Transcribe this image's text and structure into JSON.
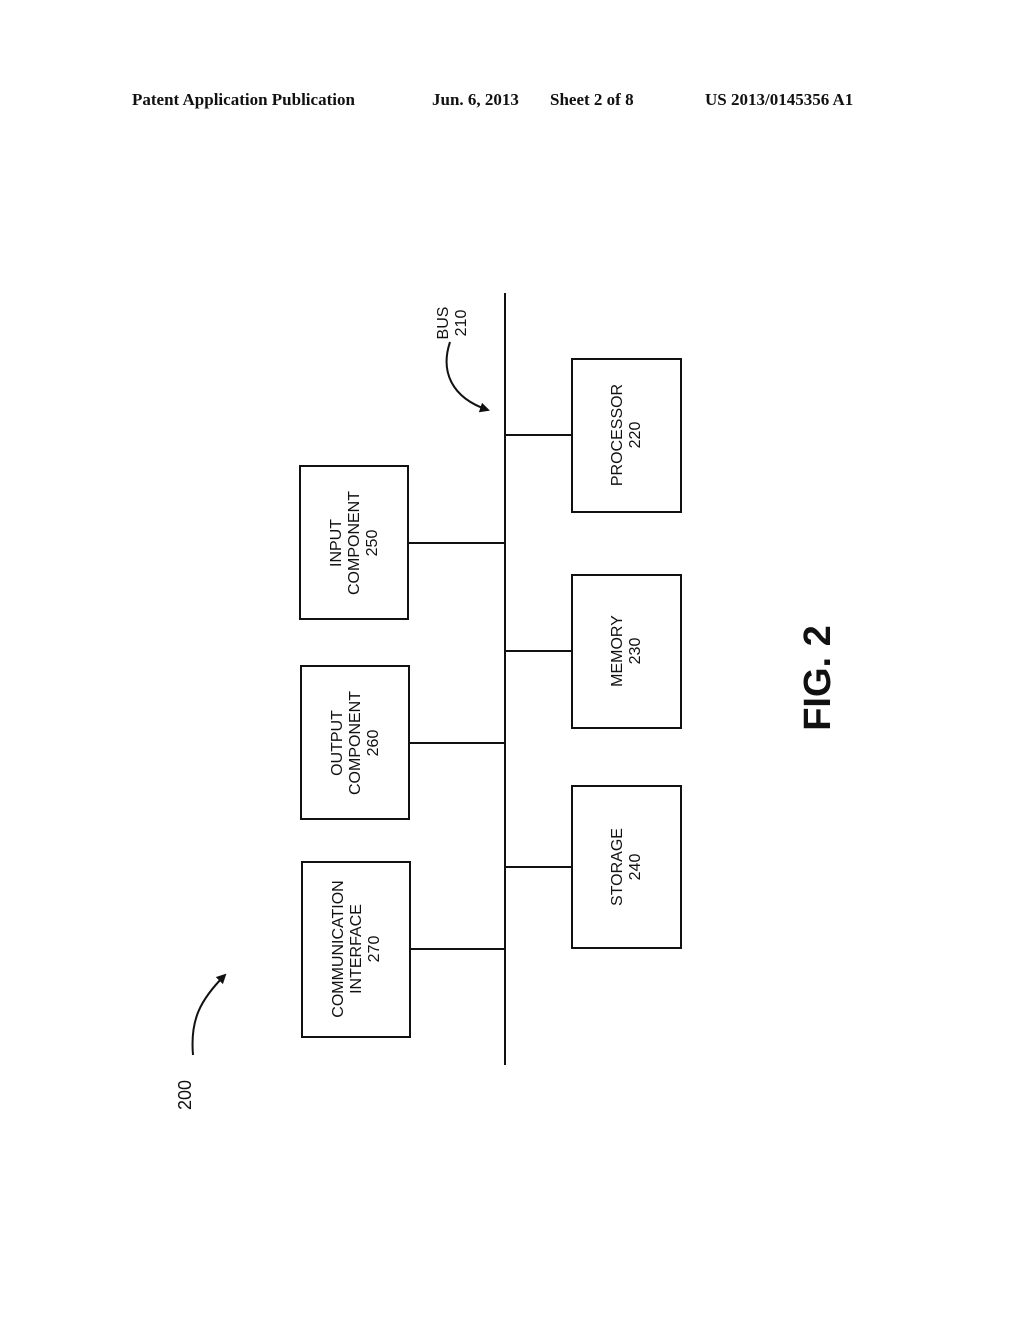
{
  "header": {
    "publication": "Patent Application Publication",
    "date": "Jun. 6, 2013",
    "sheet": "Sheet 2 of 8",
    "number": "US 2013/0145356 A1"
  },
  "figure": {
    "label": "FIG. 2",
    "ref": "200",
    "bus": {
      "name": "BUS",
      "ref": "210"
    },
    "components": [
      {
        "id": "processor",
        "lines": [
          "PROCESSOR",
          "220"
        ]
      },
      {
        "id": "memory",
        "lines": [
          "MEMORY",
          "230"
        ]
      },
      {
        "id": "storage",
        "lines": [
          "STORAGE",
          "240"
        ]
      },
      {
        "id": "input-component",
        "lines": [
          "INPUT",
          "COMPONENT",
          "250"
        ]
      },
      {
        "id": "output-component",
        "lines": [
          "OUTPUT",
          "COMPONENT",
          "260"
        ]
      },
      {
        "id": "communication-interface",
        "lines": [
          "COMMUNICATION",
          "INTERFACE",
          "270"
        ]
      }
    ]
  }
}
